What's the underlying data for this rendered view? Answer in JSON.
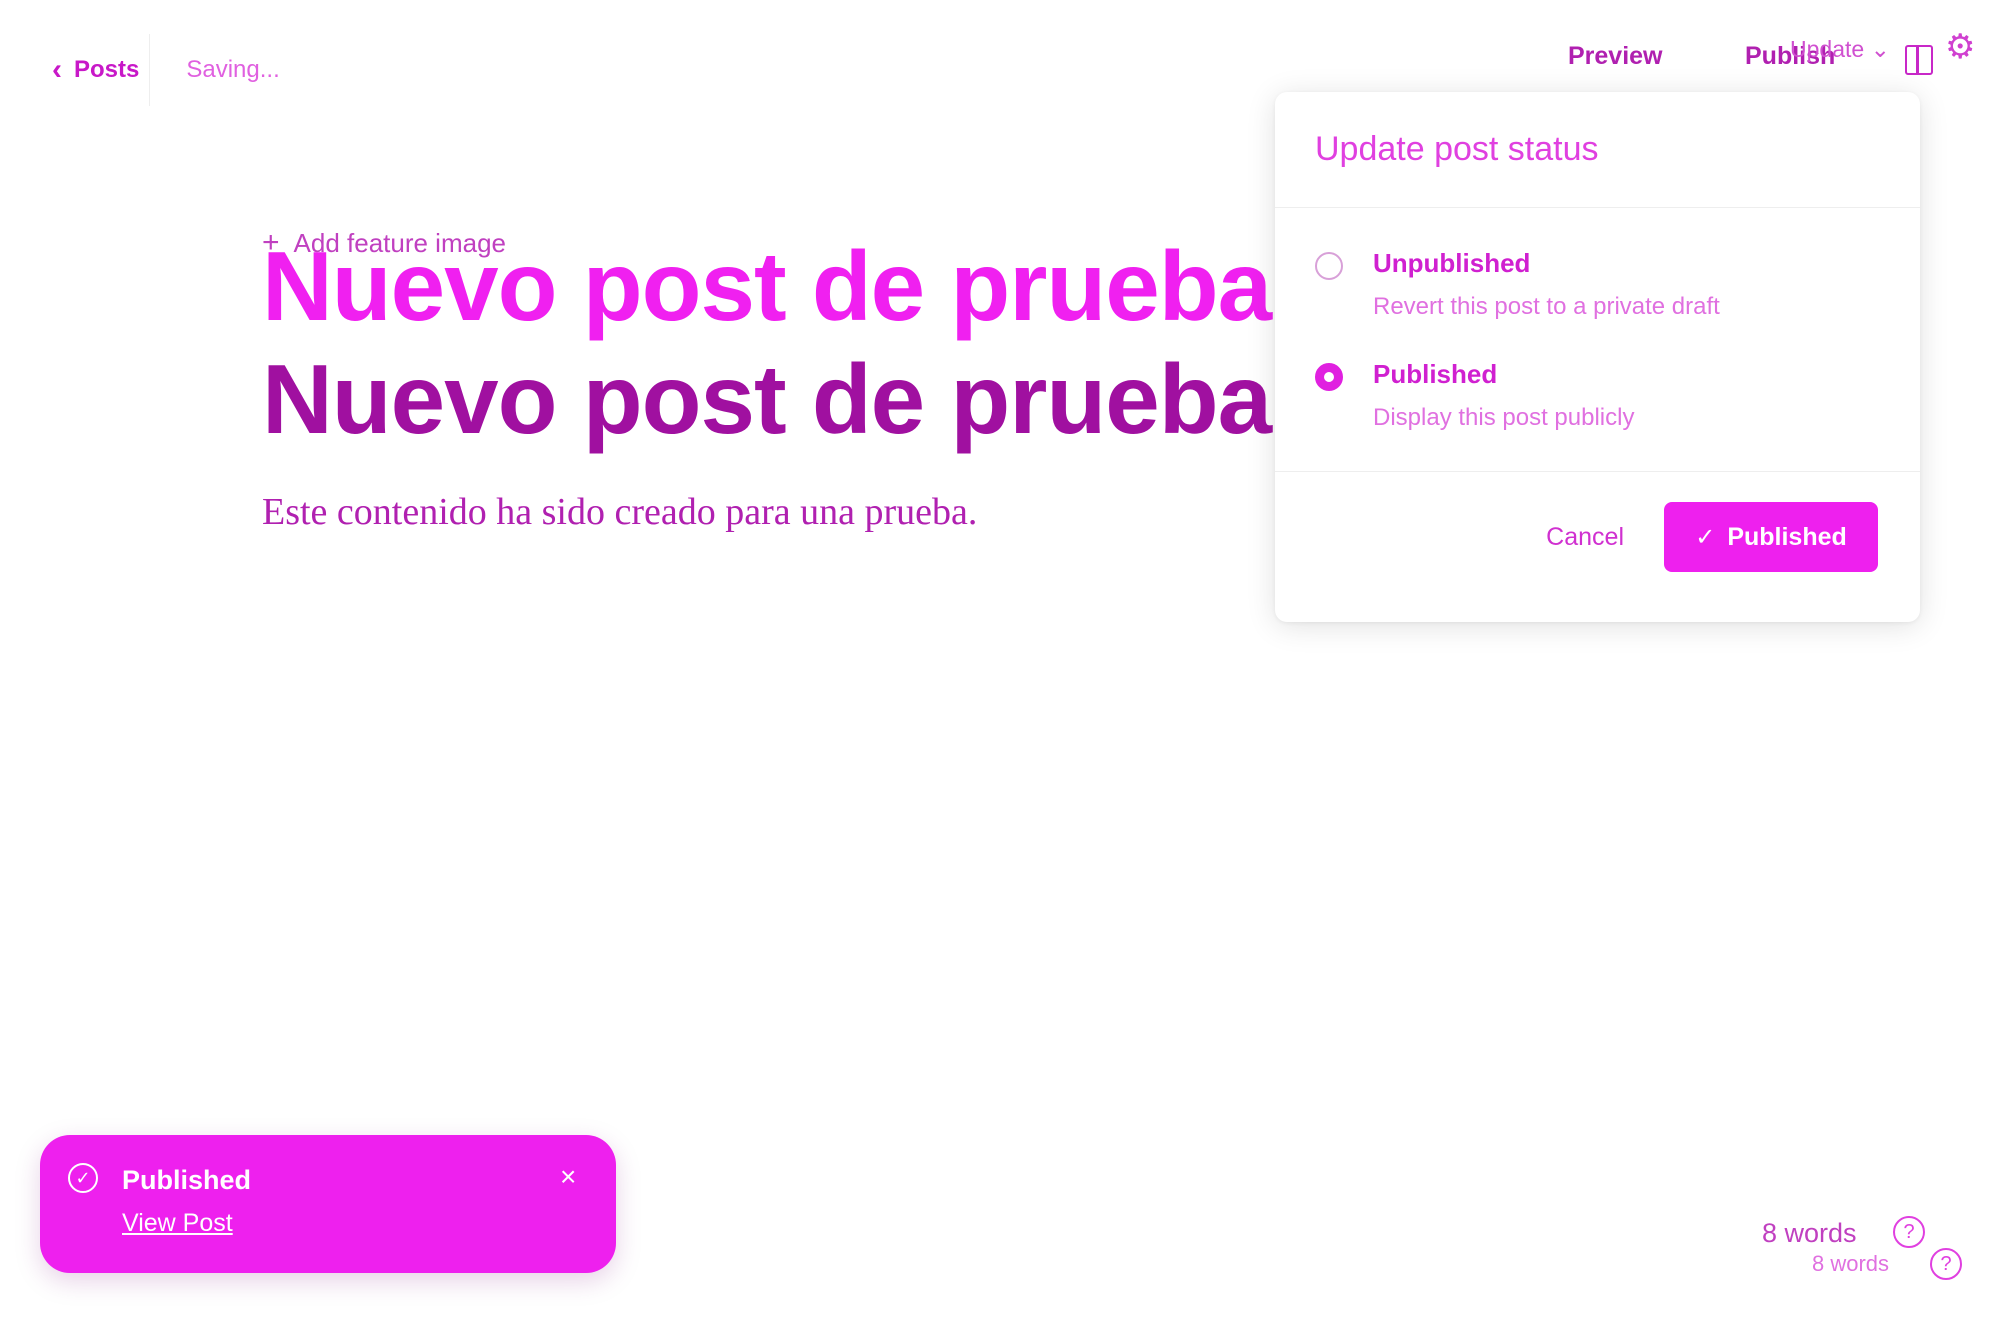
{
  "header": {
    "back_label": "Posts",
    "status_text": "Saving...",
    "preview_label": "Preview",
    "publish_label": "Publish",
    "update_label": "Update",
    "icons": {
      "back": "chevron-left-icon",
      "sidebar": "sidebar-toggle-icon",
      "settings": "gear-icon"
    }
  },
  "editor": {
    "feature_image_label": "Add feature image",
    "title": "Nuevo post de prueba",
    "body": "Este contenido ha sido creado para una prueba."
  },
  "status_popover": {
    "title": "Update post status",
    "options": [
      {
        "label": "Unpublished",
        "description": "Revert this post to a private draft",
        "selected": false
      },
      {
        "label": "Published",
        "description": "Display this post publicly",
        "selected": true
      }
    ],
    "cancel_label": "Cancel",
    "confirm_label": "Published"
  },
  "toast": {
    "title": "Published",
    "link_label": "View Post",
    "close_glyph": "×"
  },
  "footer": {
    "word_count": "8 words",
    "help_glyph": "?"
  },
  "colors": {
    "accent": "#ee20ee",
    "text": "#c020c0"
  }
}
